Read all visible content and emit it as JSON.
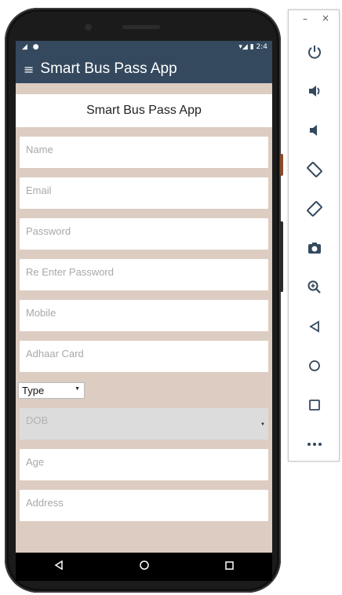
{
  "status_bar": {
    "left": "◢ ●",
    "right": "▾◢ ▮ 2:4"
  },
  "app_bar": {
    "menu_icon": "≡",
    "title": "Smart Bus Pass App"
  },
  "form": {
    "header": "Smart Bus Pass App",
    "fields": [
      {
        "placeholder": "Name"
      },
      {
        "placeholder": "Email"
      },
      {
        "placeholder": "Password"
      },
      {
        "placeholder": "Re Enter Password"
      },
      {
        "placeholder": "Mobile"
      },
      {
        "placeholder": "Adhaar Card"
      }
    ],
    "type_select": {
      "value": "Type"
    },
    "dob": {
      "placeholder": "DOB"
    },
    "more_fields": [
      {
        "placeholder": "Age"
      },
      {
        "placeholder": "Address"
      }
    ]
  },
  "toolbar": {
    "minimize": "–",
    "close": "×",
    "buttons": [
      "power-icon",
      "volume-up-icon",
      "volume-down-icon",
      "rotate-left-icon",
      "rotate-right-icon",
      "camera-icon",
      "zoom-icon",
      "back-icon",
      "home-icon",
      "overview-icon",
      "more-icon"
    ]
  },
  "colors": {
    "app_bar": "#34495e",
    "background": "#dcccc1",
    "toolbar_icon": "#34495e"
  }
}
